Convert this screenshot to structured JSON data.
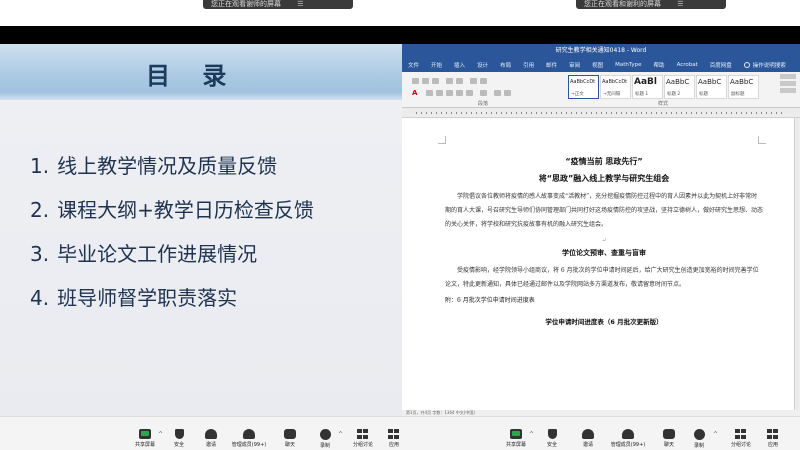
{
  "share_notices": [
    {
      "text": "您正在观看谢师的屏幕",
      "icon": "menu-icon"
    },
    {
      "text": "您正在观看和谢利的屏幕",
      "icon": "menu-icon"
    }
  ],
  "slide": {
    "title": "目 录",
    "items": [
      {
        "num": "1.",
        "text": "线上教学情况及质量反馈"
      },
      {
        "num": "2.",
        "text": "课程大纲+教学日历检查反馈"
      },
      {
        "num": "3.",
        "text": "毕业论文工作进展情况"
      },
      {
        "num": "4.",
        "text": "班导师督学职责落实"
      }
    ]
  },
  "word": {
    "window_title": "研究生教学相关通知0418 - Word",
    "tabs": [
      "文件",
      "开始",
      "插入",
      "设计",
      "布局",
      "引用",
      "邮件",
      "审阅",
      "视图",
      "MathType",
      "帮助",
      "Acrobat",
      "百度网盘"
    ],
    "tell_me": "操作说明搜索",
    "ribbon": {
      "group_paragraph": "段落",
      "group_styles": "样式",
      "styles": [
        {
          "preview": "AaBbCcDt",
          "name": "→正文",
          "size": "small"
        },
        {
          "preview": "AaBbCcDt",
          "name": "→无间隔",
          "size": "small"
        },
        {
          "preview": "AaBl",
          "name": "标题 1",
          "size": "big"
        },
        {
          "preview": "AaBbC",
          "name": "标题 2",
          "size": "mid"
        },
        {
          "preview": "AaBbC",
          "name": "标题",
          "size": "mid"
        },
        {
          "preview": "AaBbC",
          "name": "副标题",
          "size": "mid"
        }
      ]
    },
    "document": {
      "heading1": "“疫情当前 思政先行”",
      "heading2": "将“思政”融入线上教学与研究生组会",
      "para1": "学院倡议各位教师将疫情的感人故事变成“活教材”，充分挖掘疫情防控过程中的育人因素并以此为契机上好非常时期的育人大课，号召研究生导师们协同管理部门共同打好这场疫情防控的攻坚战，坚持立德树人，做好研究生思想、动态的关心关怀，将学校和研究抗疫故事有机的融入研究生组会。",
      "heading3": "学位论文预审、查重与盲审",
      "para2": "受疫情影响，经学院领导小组商议，将 6 月批次的学位申请时间延后，给广大研究生创造更加宽裕的时间完善学位论文，特此更新通知，具体已经通过邮件以及学院网站多方渠道发布，敬请留意时间节点。",
      "note": "附：6 月批次学位申请时间进度表",
      "table_title": "学位申请时间进度表（6 月批次更新版）"
    },
    "status": "第1页，共4页  字数：1364  中文(中国)"
  },
  "toolbar_left": [
    {
      "label": "共享屏幕",
      "icon": "share-screen-icon"
    },
    {
      "label": "安全",
      "icon": "shield-icon"
    },
    {
      "label": "邀请",
      "icon": "invite-icon"
    },
    {
      "label": "管理成员(99+)",
      "icon": "members-icon"
    },
    {
      "label": "聊天",
      "icon": "chat-icon"
    },
    {
      "label": "录制",
      "icon": "record-icon"
    },
    {
      "label": "分组讨论",
      "icon": "breakout-icon"
    },
    {
      "label": "应用",
      "icon": "apps-icon"
    }
  ],
  "toolbar_right": [
    {
      "label": "共享屏幕",
      "icon": "share-screen-icon"
    },
    {
      "label": "安全",
      "icon": "shield-icon"
    },
    {
      "label": "邀请",
      "icon": "invite-icon"
    },
    {
      "label": "管理成员(99+)",
      "icon": "members-icon"
    },
    {
      "label": "聊天",
      "icon": "chat-icon"
    },
    {
      "label": "录制",
      "icon": "record-icon"
    },
    {
      "label": "分组讨论",
      "icon": "breakout-icon"
    },
    {
      "label": "应用",
      "icon": "apps-icon"
    }
  ]
}
